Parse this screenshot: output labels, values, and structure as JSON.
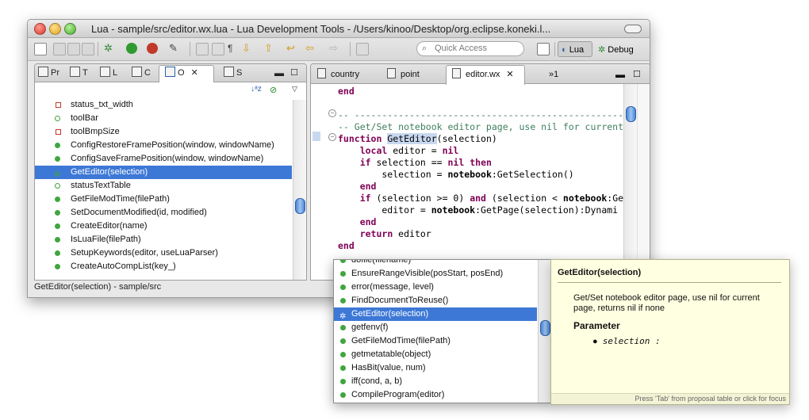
{
  "window": {
    "title": "Lua - sample/src/editor.wx.lua - Lua Development Tools - /Users/kinoo/Desktop/org.eclipse.koneki.l..."
  },
  "toolbar": {
    "quick_access_placeholder": "Quick Access",
    "perspectives": [
      {
        "label": "Lua",
        "active": true
      },
      {
        "label": "Debug",
        "active": false
      }
    ]
  },
  "left_panel": {
    "tabs": [
      {
        "label": "Pr",
        "active": false
      },
      {
        "label": "T",
        "active": false
      },
      {
        "label": "L",
        "active": false
      },
      {
        "label": "C",
        "active": false
      },
      {
        "label": "O",
        "active": true
      },
      {
        "label": "S",
        "active": false
      }
    ],
    "outline_items": [
      {
        "label": "status_txt_width",
        "icon": "field-red",
        "selected": false
      },
      {
        "label": "toolBar",
        "icon": "local-variable",
        "selected": false
      },
      {
        "label": "toolBmpSize",
        "icon": "field-red",
        "selected": false
      },
      {
        "label": "ConfigRestoreFramePosition(window, windowName)",
        "icon": "function",
        "selected": false
      },
      {
        "label": "ConfigSaveFramePosition(window, windowName)",
        "icon": "function",
        "selected": false
      },
      {
        "label": "GetEditor(selection)",
        "icon": "function-bug",
        "selected": true
      },
      {
        "label": "statusTextTable",
        "icon": "local-variable",
        "selected": false
      },
      {
        "label": "GetFileModTime(filePath)",
        "icon": "function",
        "selected": false
      },
      {
        "label": "SetDocumentModified(id, modified)",
        "icon": "function",
        "selected": false
      },
      {
        "label": "CreateEditor(name)",
        "icon": "function",
        "selected": false
      },
      {
        "label": "IsLuaFile(filePath)",
        "icon": "function",
        "selected": false
      },
      {
        "label": "SetupKeywords(editor, useLuaParser)",
        "icon": "function",
        "selected": false
      },
      {
        "label": "CreateAutoCompList(key_)",
        "icon": "function",
        "selected": false
      }
    ]
  },
  "status_bar": {
    "text": "GetEditor(selection) - sample/src"
  },
  "editor": {
    "tabs": [
      {
        "label": "country",
        "active": false
      },
      {
        "label": "point",
        "active": false
      },
      {
        "label": "editor.wx",
        "active": true
      }
    ],
    "overflow_label": "»1"
  },
  "completion": {
    "items": [
      {
        "label": "dofile(filename)",
        "selected": false
      },
      {
        "label": "EnsureRangeVisible(posStart, posEnd)",
        "selected": false
      },
      {
        "label": "error(message, level)",
        "selected": false
      },
      {
        "label": "FindDocumentToReuse()",
        "selected": false
      },
      {
        "label": "GetEditor(selection)",
        "selected": true
      },
      {
        "label": "getfenv(f)",
        "selected": false
      },
      {
        "label": "GetFileModTime(filePath)",
        "selected": false
      },
      {
        "label": "getmetatable(object)",
        "selected": false
      },
      {
        "label": "HasBit(value, num)",
        "selected": false
      },
      {
        "label": "iff(cond, a, b)",
        "selected": false
      },
      {
        "label": "CompileProgram(editor)",
        "selected": false
      }
    ]
  },
  "doc_popup": {
    "title": "GetEditor(selection)",
    "description": "Get/Set notebook editor page, use nil for current page, returns nil if none",
    "parameter_heading": "Parameter",
    "parameter_item": "selection :",
    "footer": "Press 'Tab' from proposal table or click for focus"
  }
}
